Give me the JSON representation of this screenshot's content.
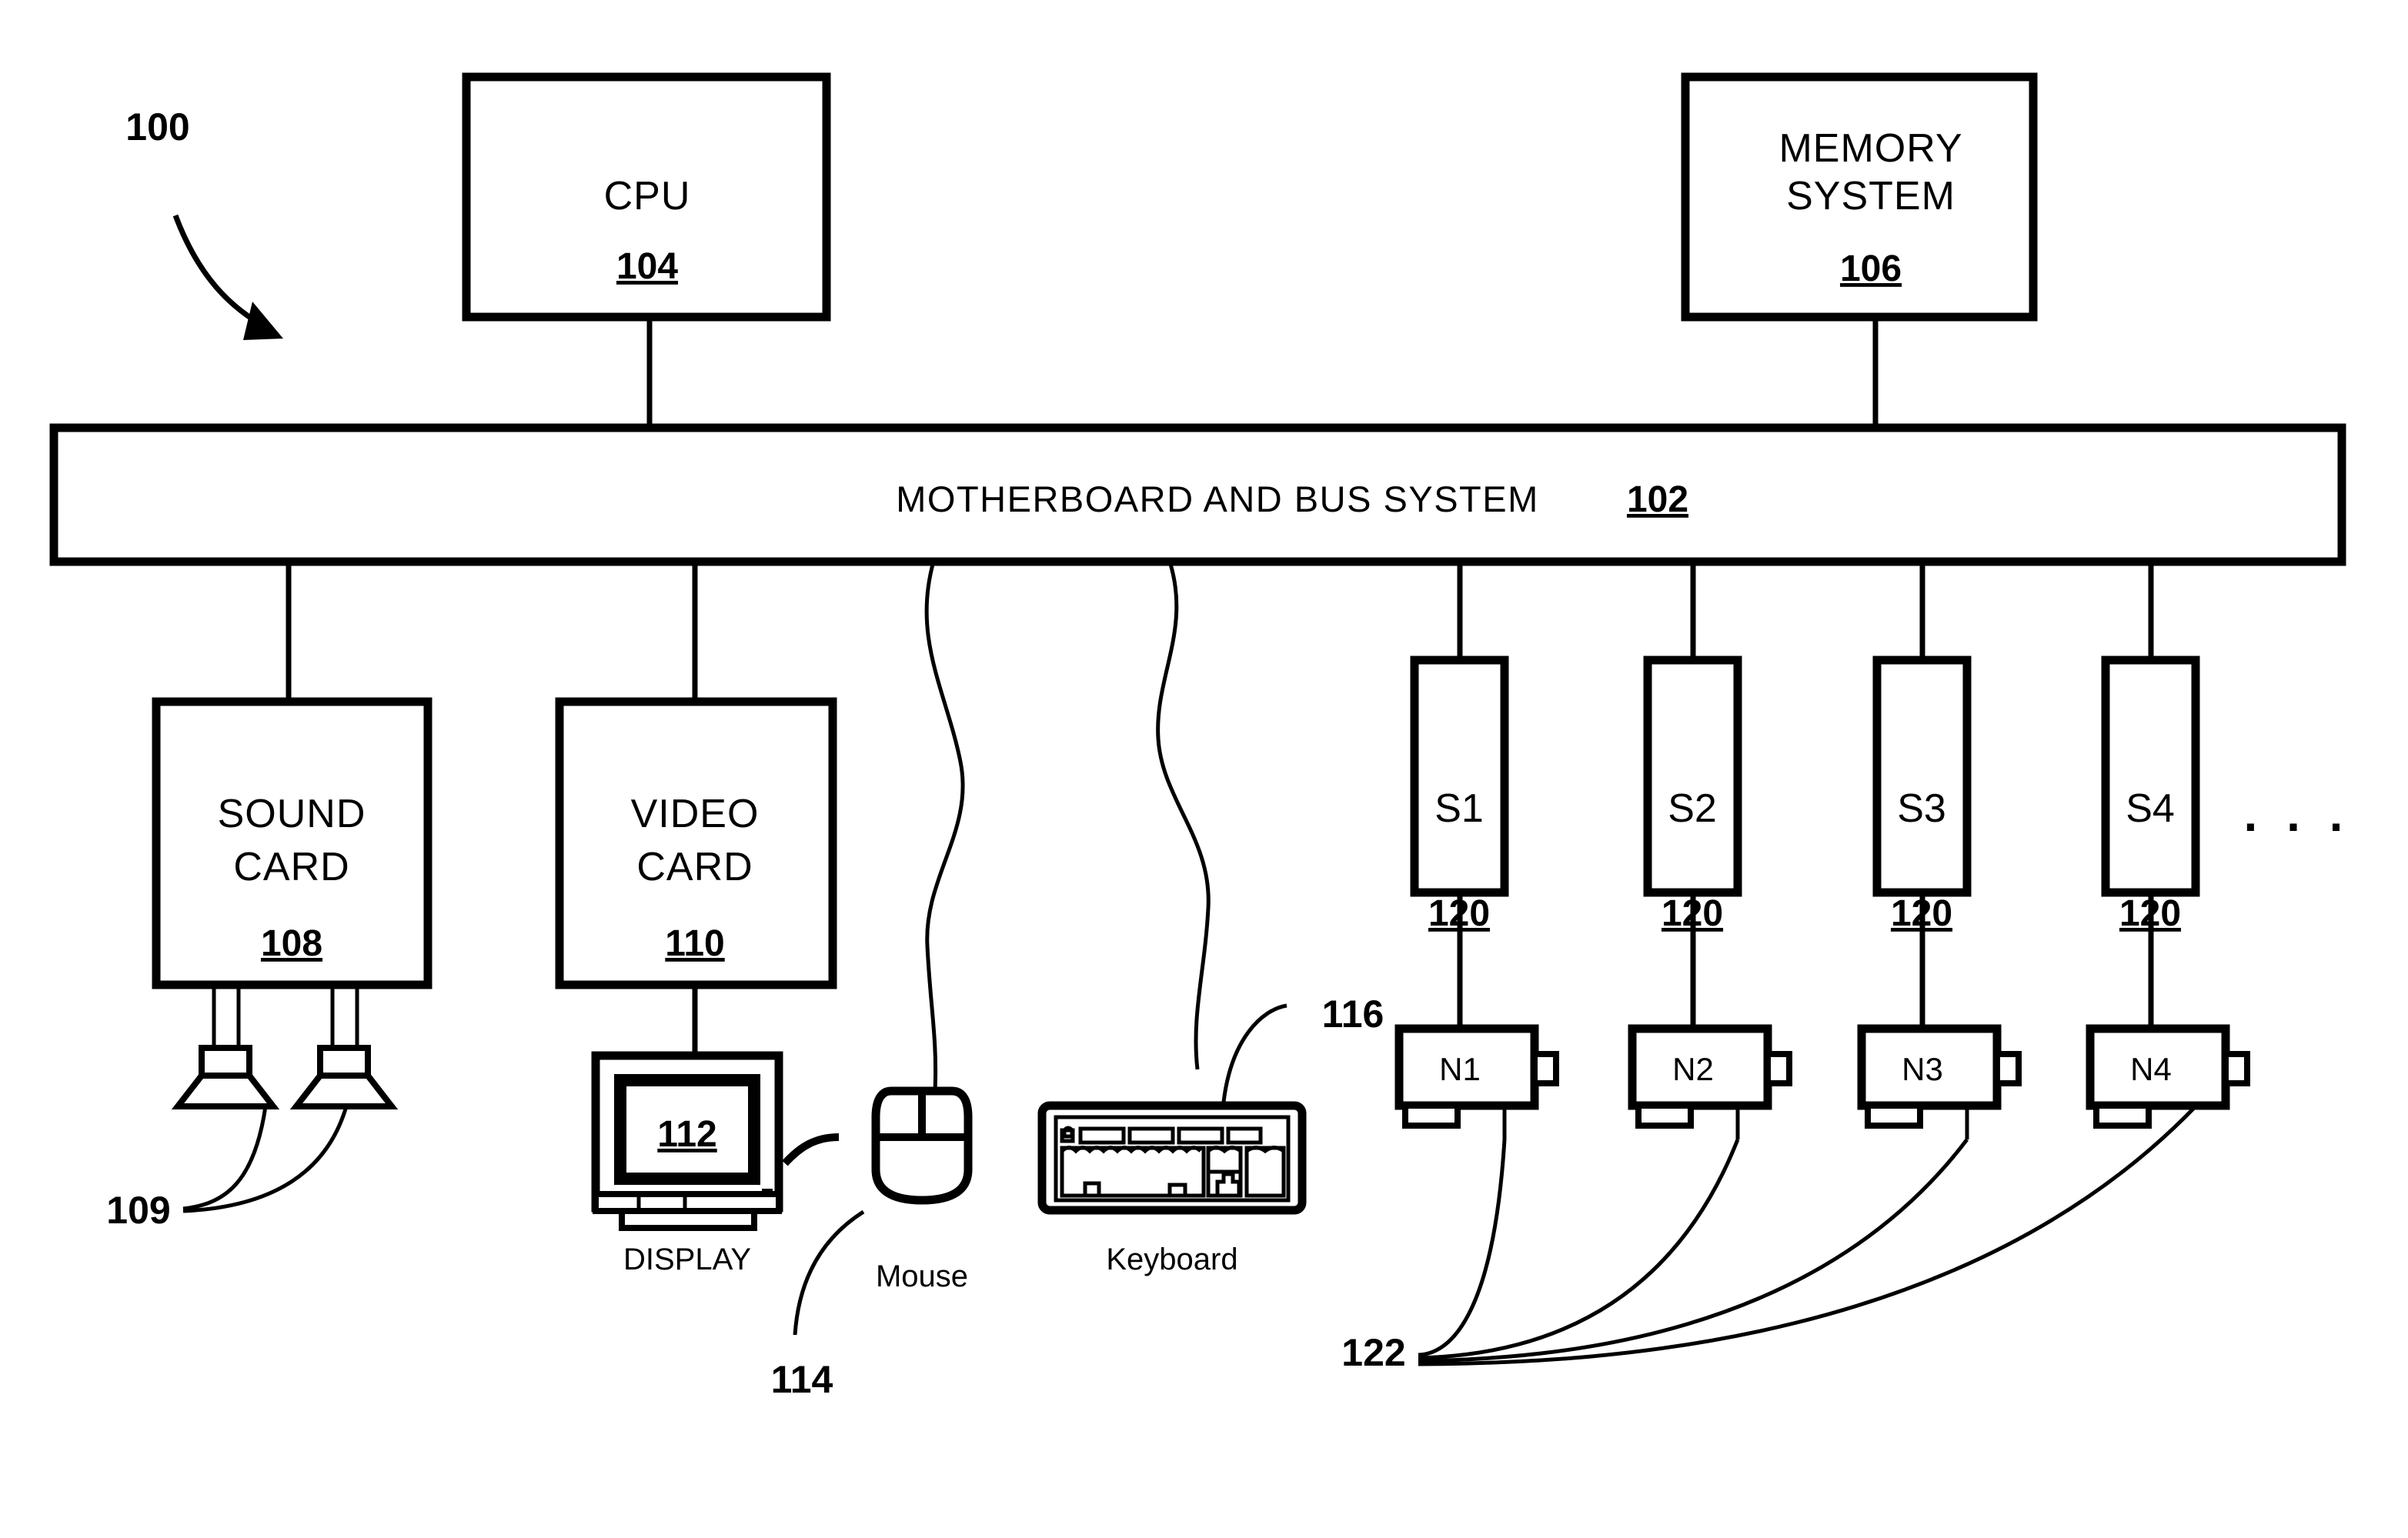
{
  "figure": {
    "system_ref": "100",
    "bus": {
      "label": "MOTHERBOARD AND BUS SYSTEM",
      "ref": "102"
    },
    "top_blocks": [
      {
        "name": "cpu",
        "lines": [
          "CPU"
        ],
        "ref": "104"
      },
      {
        "name": "memory-system",
        "lines": [
          "MEMORY",
          "SYSTEM"
        ],
        "ref": "106"
      }
    ],
    "bottom_blocks": [
      {
        "name": "sound-card",
        "lines": [
          "SOUND",
          "CARD"
        ],
        "ref": "108"
      },
      {
        "name": "video-card",
        "lines": [
          "VIDEO",
          "CARD"
        ],
        "ref": "110"
      }
    ],
    "peripherals": {
      "speakers_ref": "109",
      "display_ref": "112",
      "display_label": "DISPLAY",
      "mouse_label": "Mouse",
      "mouse_ref": "114",
      "keyboard_label": "Keyboard",
      "keyboard_ref": "116"
    },
    "device_columns": [
      {
        "slot": "S1",
        "slot_ref": "120",
        "node": "N1"
      },
      {
        "slot": "S2",
        "slot_ref": "120",
        "node": "N2"
      },
      {
        "slot": "S3",
        "slot_ref": "120",
        "node": "N3"
      },
      {
        "slot": "S4",
        "slot_ref": "120",
        "node": "N4"
      }
    ],
    "device_bundle_ref": "122",
    "continuation": ". . .",
    "colors": {
      "ink": "#000000",
      "paper": "#ffffff"
    }
  }
}
